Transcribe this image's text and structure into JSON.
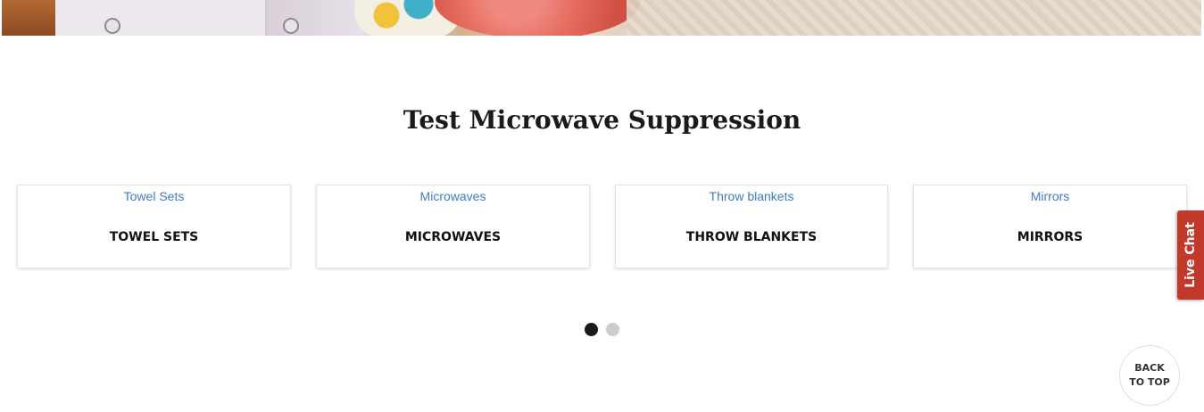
{
  "section": {
    "title": "Test Microwave Suppression"
  },
  "categories": [
    {
      "link_label": "Towel Sets",
      "name": "TOWEL SETS"
    },
    {
      "link_label": "Microwaves",
      "name": "MICROWAVES"
    },
    {
      "link_label": "Throw blankets",
      "name": "THROW BLANKETS"
    },
    {
      "link_label": "Mirrors",
      "name": "MIRRORS"
    }
  ],
  "carousel": {
    "page_count": 2,
    "active_index": 0,
    "active_color": "#1a1a1a",
    "inactive_color": "#cccccc"
  },
  "live_chat": {
    "label": "Live Chat",
    "color": "#c0392b"
  },
  "back_to_top": {
    "label": "BACK TO TOP"
  },
  "colors": {
    "link": "#3d7ec2",
    "title": "#1a1a1a"
  }
}
